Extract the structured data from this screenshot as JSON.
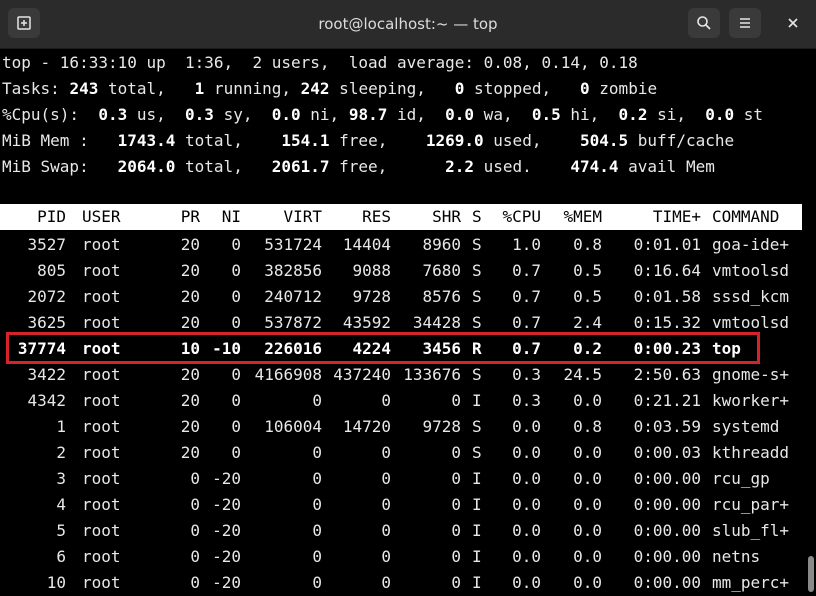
{
  "window": {
    "title": "root@localhost:~ — top"
  },
  "summary": {
    "line1": "top - 16:33:10 up  1:36,  2 users,  load average: 0.08, 0.14, 0.18",
    "tasks": [
      {
        "t": "Tasks: "
      },
      {
        "t": "243",
        "b": true
      },
      {
        "t": " total,   "
      },
      {
        "t": "1",
        "b": true
      },
      {
        "t": " running, "
      },
      {
        "t": "242",
        "b": true
      },
      {
        "t": " sleeping,   "
      },
      {
        "t": "0",
        "b": true
      },
      {
        "t": " stopped,   "
      },
      {
        "t": "0",
        "b": true
      },
      {
        "t": " zombie"
      }
    ],
    "cpu": [
      {
        "t": "%Cpu(s):  "
      },
      {
        "t": "0.3",
        "b": true
      },
      {
        "t": " us,  "
      },
      {
        "t": "0.3",
        "b": true
      },
      {
        "t": " sy,  "
      },
      {
        "t": "0.0",
        "b": true
      },
      {
        "t": " ni, "
      },
      {
        "t": "98.7",
        "b": true
      },
      {
        "t": " id,  "
      },
      {
        "t": "0.0",
        "b": true
      },
      {
        "t": " wa,  "
      },
      {
        "t": "0.5",
        "b": true
      },
      {
        "t": " hi,  "
      },
      {
        "t": "0.2",
        "b": true
      },
      {
        "t": " si,  "
      },
      {
        "t": "0.0",
        "b": true
      },
      {
        "t": " st"
      }
    ],
    "mem": [
      {
        "t": "MiB Mem :   "
      },
      {
        "t": "1743.4",
        "b": true
      },
      {
        "t": " total,    "
      },
      {
        "t": "154.1",
        "b": true
      },
      {
        "t": " free,    "
      },
      {
        "t": "1269.0",
        "b": true
      },
      {
        "t": " used,    "
      },
      {
        "t": "504.5",
        "b": true
      },
      {
        "t": " buff/cache"
      }
    ],
    "swap": [
      {
        "t": "MiB Swap:   "
      },
      {
        "t": "2064.0",
        "b": true
      },
      {
        "t": " total,   "
      },
      {
        "t": "2061.7",
        "b": true
      },
      {
        "t": " free,      "
      },
      {
        "t": "2.2",
        "b": true
      },
      {
        "t": " used.    "
      },
      {
        "t": "474.4",
        "b": true
      },
      {
        "t": " avail Mem"
      }
    ]
  },
  "columns": [
    "PID",
    "USER",
    "PR",
    "NI",
    "VIRT",
    "RES",
    "SHR",
    "S",
    "%CPU",
    "%MEM",
    "TIME+",
    "COMMAND"
  ],
  "processes": [
    [
      "3527",
      "root",
      "20",
      "0",
      "531724",
      "14404",
      "8960",
      "S",
      "1.0",
      "0.8",
      "0:01.01",
      "goa-ide+"
    ],
    [
      "805",
      "root",
      "20",
      "0",
      "382856",
      "9088",
      "7680",
      "S",
      "0.7",
      "0.5",
      "0:16.64",
      "vmtoolsd"
    ],
    [
      "2072",
      "root",
      "20",
      "0",
      "240712",
      "9728",
      "8576",
      "S",
      "0.7",
      "0.5",
      "0:01.58",
      "sssd_kcm"
    ],
    [
      "3625",
      "root",
      "20",
      "0",
      "537872",
      "43592",
      "34428",
      "S",
      "0.7",
      "2.4",
      "0:15.32",
      "vmtoolsd"
    ],
    [
      "37774",
      "root",
      "10",
      "-10",
      "226016",
      "4224",
      "3456",
      "R",
      "0.7",
      "0.2",
      "0:00.23",
      "top"
    ],
    [
      "3422",
      "root",
      "20",
      "0",
      "4166908",
      "437240",
      "133676",
      "S",
      "0.3",
      "24.5",
      "2:50.63",
      "gnome-s+"
    ],
    [
      "4342",
      "root",
      "20",
      "0",
      "0",
      "0",
      "0",
      "I",
      "0.3",
      "0.0",
      "0:21.21",
      "kworker+"
    ],
    [
      "1",
      "root",
      "20",
      "0",
      "106004",
      "14720",
      "9728",
      "S",
      "0.0",
      "0.8",
      "0:03.59",
      "systemd"
    ],
    [
      "2",
      "root",
      "20",
      "0",
      "0",
      "0",
      "0",
      "S",
      "0.0",
      "0.0",
      "0:00.03",
      "kthreadd"
    ],
    [
      "3",
      "root",
      "0",
      "-20",
      "0",
      "0",
      "0",
      "I",
      "0.0",
      "0.0",
      "0:00.00",
      "rcu_gp"
    ],
    [
      "4",
      "root",
      "0",
      "-20",
      "0",
      "0",
      "0",
      "I",
      "0.0",
      "0.0",
      "0:00.00",
      "rcu_par+"
    ],
    [
      "5",
      "root",
      "0",
      "-20",
      "0",
      "0",
      "0",
      "I",
      "0.0",
      "0.0",
      "0:00.00",
      "slub_fl+"
    ],
    [
      "6",
      "root",
      "0",
      "-20",
      "0",
      "0",
      "0",
      "I",
      "0.0",
      "0.0",
      "0:00.00",
      "netns"
    ],
    [
      "10",
      "root",
      "0",
      "-20",
      "0",
      "0",
      "0",
      "I",
      "0.0",
      "0.0",
      "0:00.00",
      "mm_perc+"
    ]
  ],
  "highlighted_pid": "37774",
  "colors": {
    "highlight": "#d4242a",
    "header_bg": "#ffffff",
    "terminal_bg": "#000000"
  }
}
